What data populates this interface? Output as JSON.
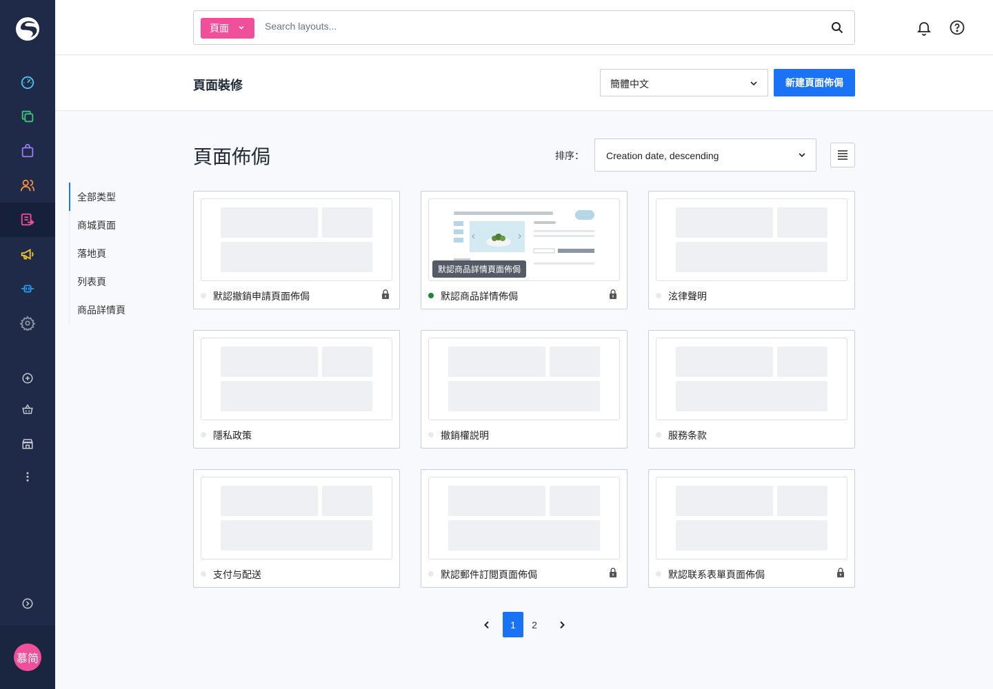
{
  "sidebar": {
    "logo_icon": "shopware-logo-icon",
    "items": [
      {
        "name": "dashboard",
        "icon": "gauge-icon",
        "color": "#4fc3e8"
      },
      {
        "name": "catalogues",
        "icon": "copy-icon",
        "color": "#3cc77a"
      },
      {
        "name": "orders",
        "icon": "bag-icon",
        "color": "#9b7cf5"
      },
      {
        "name": "customers",
        "icon": "users-icon",
        "color": "#f5923e"
      },
      {
        "name": "content",
        "icon": "content-icon",
        "color": "#f0509a"
      },
      {
        "name": "marketing",
        "icon": "megaphone-icon",
        "color": "#f5c523"
      },
      {
        "name": "extensions",
        "icon": "plug-icon",
        "color": "#2b9bf0"
      },
      {
        "name": "settings",
        "icon": "gear-icon",
        "color": "#8d95a5"
      },
      {
        "name": "add",
        "icon": "plus-circle-icon",
        "color": "#c5cad3"
      },
      {
        "name": "shop",
        "icon": "basket-icon",
        "color": "#c5cad3"
      },
      {
        "name": "store",
        "icon": "store-icon",
        "color": "#c5cad3"
      },
      {
        "name": "more",
        "icon": "more-vertical-icon",
        "color": "#c5cad3"
      }
    ],
    "collapse_icon": "chevron-circle-right-icon",
    "avatar_text": "慕简"
  },
  "topbar": {
    "scope_label": "頁面",
    "search_placeholder": "Search layouts..."
  },
  "header": {
    "title": "頁面裝修",
    "language": "簡體中文",
    "new_button": "新建頁面佈侷"
  },
  "content": {
    "title": "頁面佈侷",
    "sort_label": "排序：",
    "sort_value": "Creation date, descending"
  },
  "filters": [
    {
      "label": "全部类型",
      "active": true
    },
    {
      "label": "商城頁面",
      "active": false
    },
    {
      "label": "落地頁",
      "active": false
    },
    {
      "label": "列表頁",
      "active": false
    },
    {
      "label": "商品詳情頁",
      "active": false
    }
  ],
  "cards": [
    {
      "name": "默認撤銷申請頁面佈侷",
      "status": "inactive",
      "locked": true
    },
    {
      "name": "默認商品詳情佈侷",
      "status": "active",
      "locked": true,
      "tooltip": "默認商品詳情頁面佈侷"
    },
    {
      "name": "泫律聲明",
      "status": "inactive",
      "locked": false
    },
    {
      "name": "隱私政策",
      "status": "inactive",
      "locked": false
    },
    {
      "name": "撤銷權説明",
      "status": "inactive",
      "locked": false
    },
    {
      "name": "服務条款",
      "status": "inactive",
      "locked": false
    },
    {
      "name": "支付与配送",
      "status": "inactive",
      "locked": false
    },
    {
      "name": "默認郵件訂閲頁面佈侷",
      "status": "inactive",
      "locked": true
    },
    {
      "name": "默認联系表單頁面佈侷",
      "status": "inactive",
      "locked": true
    }
  ],
  "pagination": {
    "pages": [
      "1",
      "2"
    ],
    "current": "1"
  }
}
